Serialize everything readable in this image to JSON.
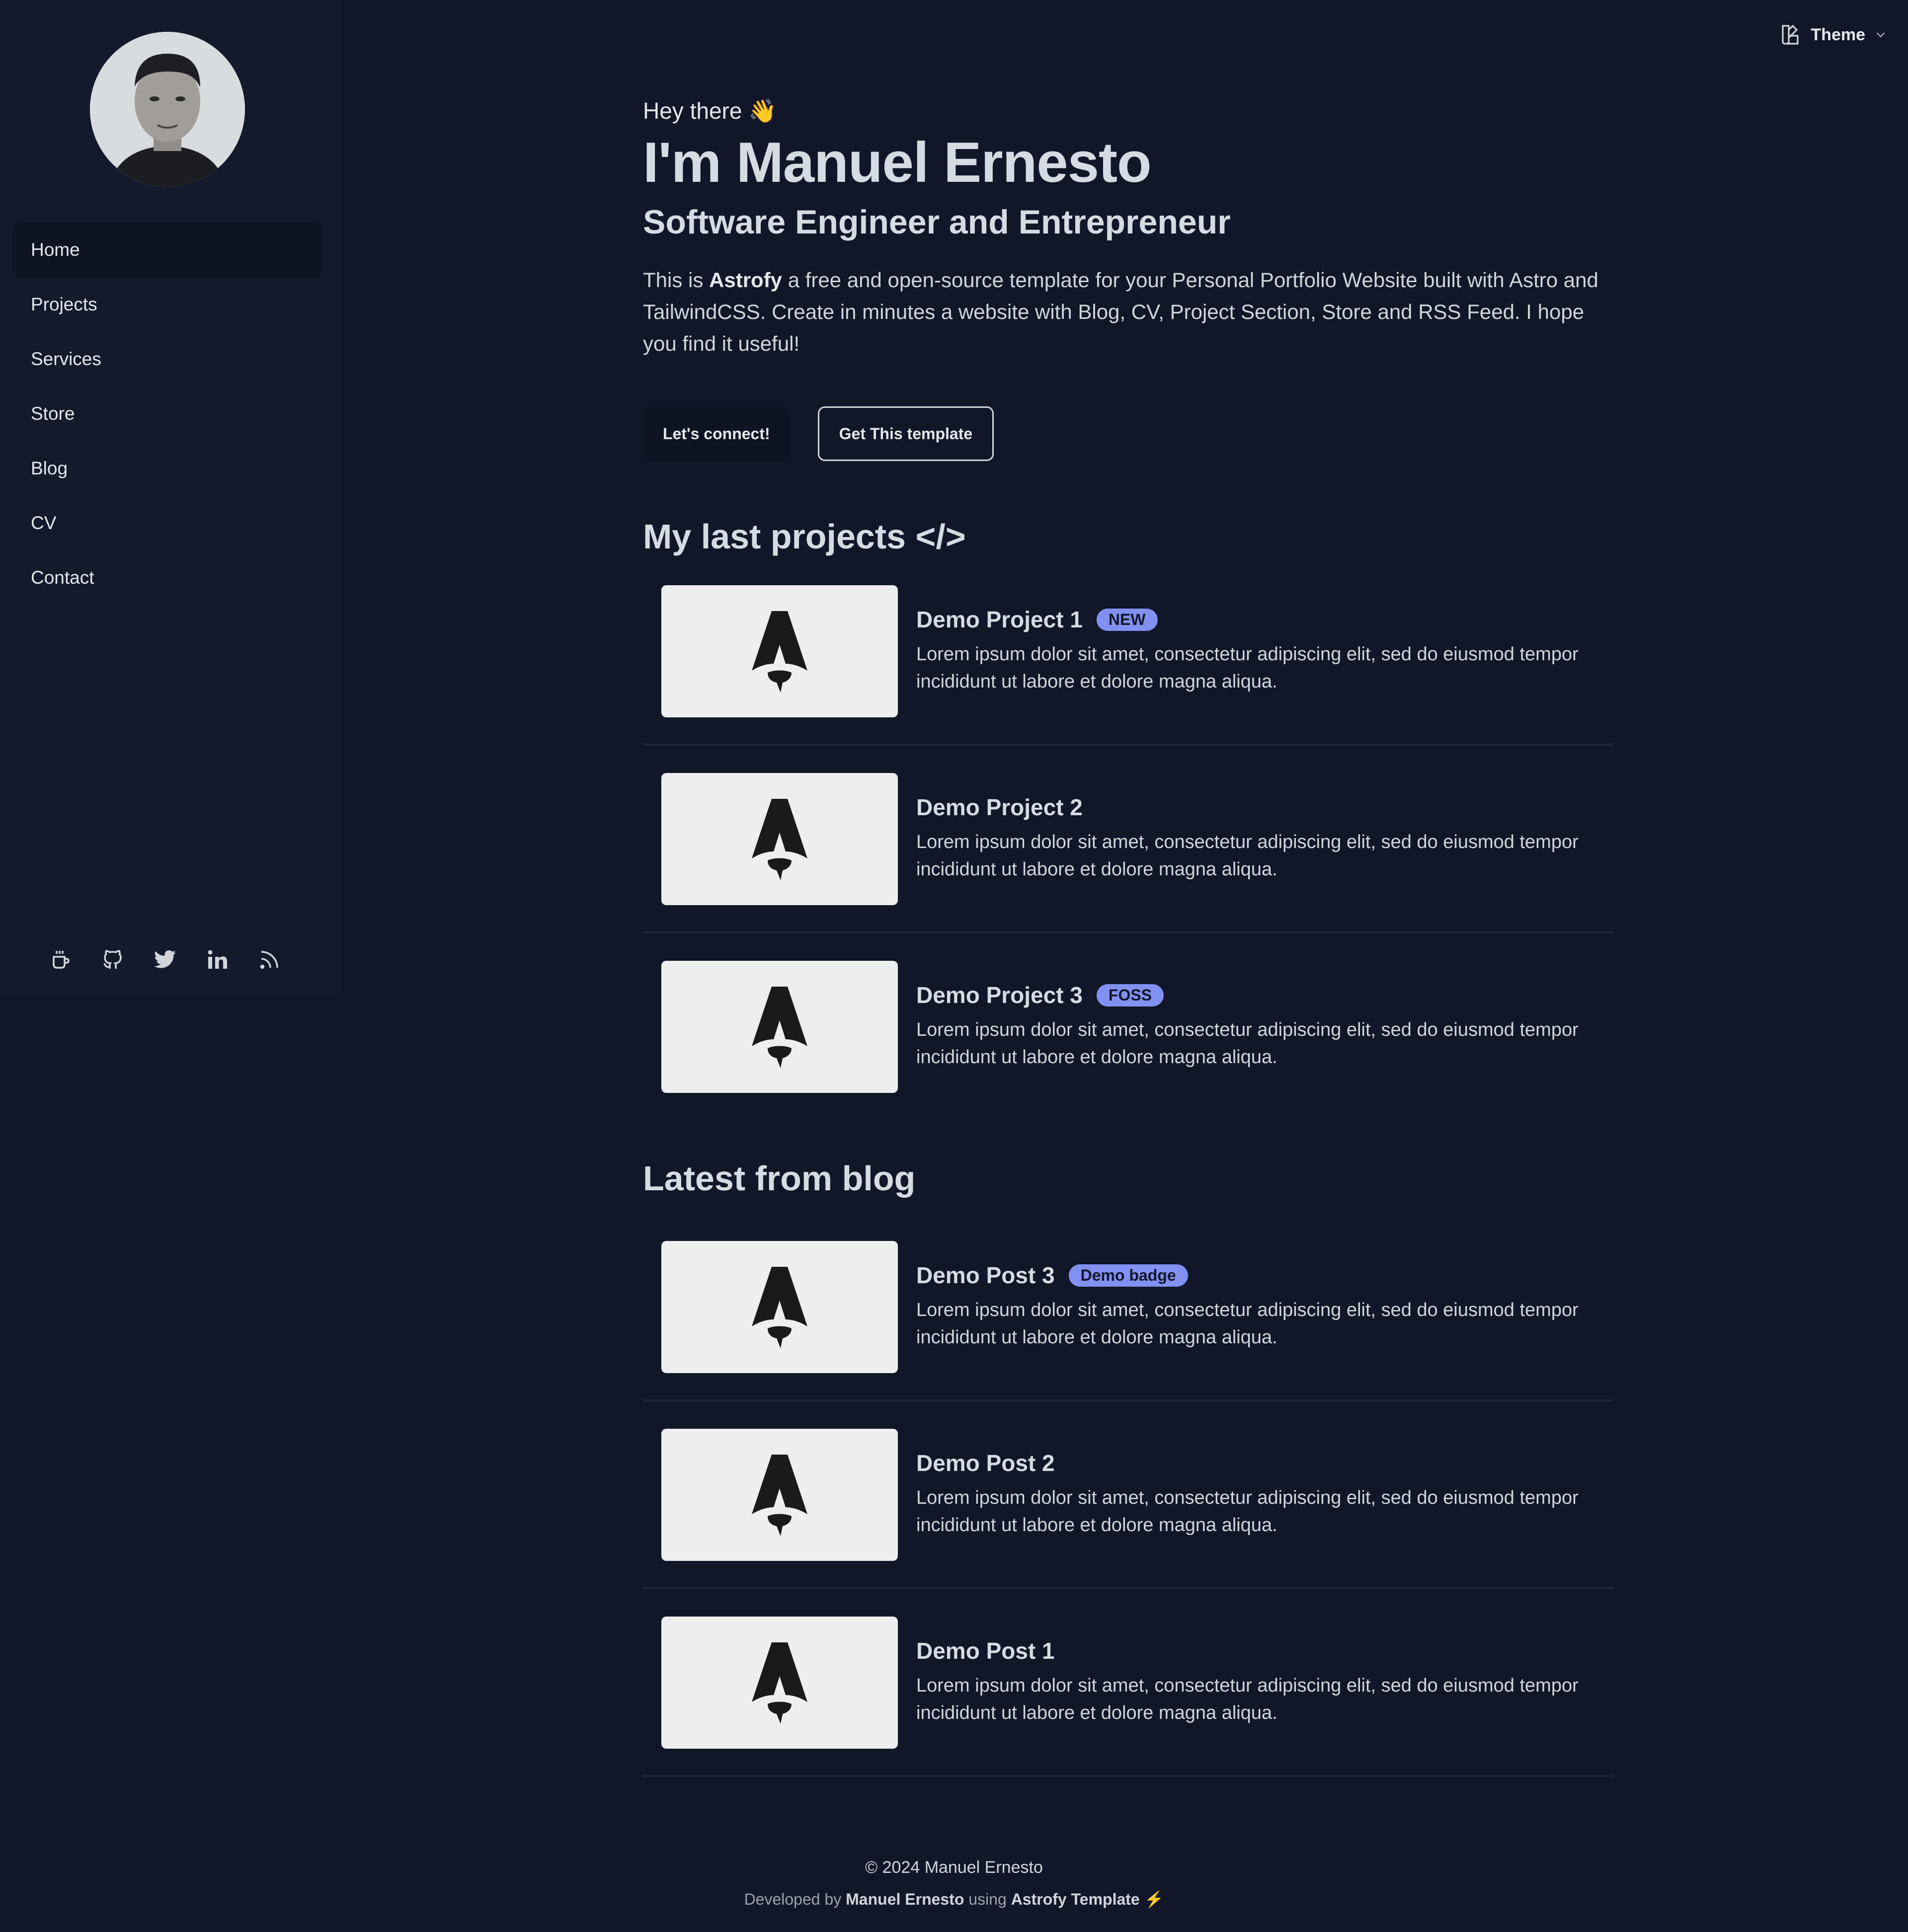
{
  "sidebar": {
    "nav": [
      {
        "label": "Home"
      },
      {
        "label": "Projects"
      },
      {
        "label": "Services"
      },
      {
        "label": "Store"
      },
      {
        "label": "Blog"
      },
      {
        "label": "CV"
      },
      {
        "label": "Contact"
      }
    ],
    "socials": [
      "coffee-icon",
      "github-icon",
      "twitter-icon",
      "linkedin-icon",
      "rss-icon"
    ]
  },
  "header": {
    "theme_label": "Theme"
  },
  "hero": {
    "greeting": "Hey there 👋",
    "name": "I'm Manuel Ernesto",
    "role": "Software Engineer and Entrepreneur",
    "intro_prefix": "This is ",
    "intro_brand": "Astrofy",
    "intro_rest": " a free and open-source template for your Personal Portfolio Website built with Astro and TailwindCSS. Create in minutes a website with Blog, CV, Project Section, Store and RSS Feed. I hope you find it useful!",
    "buttons": {
      "connect": "Let's connect!",
      "template": "Get This template"
    }
  },
  "projects": {
    "title": "My last projects </>",
    "items": [
      {
        "title": "Demo Project 1",
        "badge": "NEW",
        "desc": "Lorem ipsum dolor sit amet, consectetur adipiscing elit, sed do eiusmod tempor incididunt ut labore et dolore magna aliqua."
      },
      {
        "title": "Demo Project 2",
        "badge": "",
        "desc": "Lorem ipsum dolor sit amet, consectetur adipiscing elit, sed do eiusmod tempor incididunt ut labore et dolore magna aliqua."
      },
      {
        "title": "Demo Project 3",
        "badge": "FOSS",
        "desc": "Lorem ipsum dolor sit amet, consectetur adipiscing elit, sed do eiusmod tempor incididunt ut labore et dolore magna aliqua."
      }
    ]
  },
  "blog": {
    "title": "Latest from blog",
    "items": [
      {
        "title": "Demo Post 3",
        "badge": "Demo badge",
        "desc": "Lorem ipsum dolor sit amet, consectetur adipiscing elit, sed do eiusmod tempor incididunt ut labore et dolore magna aliqua."
      },
      {
        "title": "Demo Post 2",
        "badge": "",
        "desc": "Lorem ipsum dolor sit amet, consectetur adipiscing elit, sed do eiusmod tempor incididunt ut labore et dolore magna aliqua."
      },
      {
        "title": "Demo Post 1",
        "badge": "",
        "desc": "Lorem ipsum dolor sit amet, consectetur adipiscing elit, sed do eiusmod tempor incididunt ut labore et dolore magna aliqua."
      }
    ]
  },
  "footer": {
    "copyright": "© 2024 Manuel Ernesto",
    "dev_prefix": "Developed by ",
    "dev_name": "Manuel Ernesto",
    "dev_mid": " using ",
    "dev_template": "Astrofy Template",
    "dev_suffix": " ⚡"
  },
  "colors": {
    "background": "#111729",
    "sidebar": "#121a2c",
    "badge": "#8290f2"
  }
}
